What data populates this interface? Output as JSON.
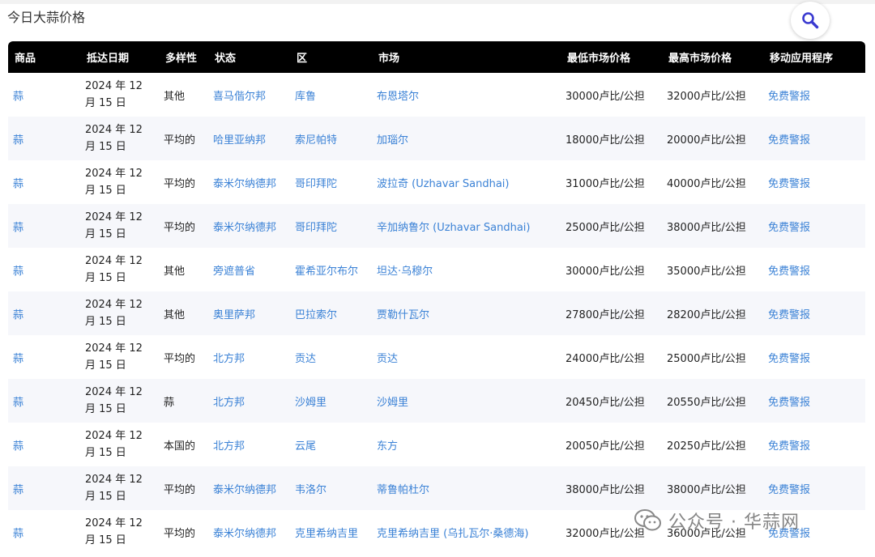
{
  "page": {
    "title": "今日大蒜价格",
    "watermark": "公众号 · 华蒜网"
  },
  "table": {
    "headers": [
      "商品",
      "抵达日期",
      "多样性",
      "状态",
      "区",
      "市场",
      "最低市场价格",
      "最高市场价格",
      "移动应用程序"
    ],
    "rows": [
      [
        "蒜",
        "2024 年 12 月 15 日",
        "其他",
        "喜马偕尔邦",
        "库鲁",
        "布恩塔尔",
        "30000卢比/公担",
        "32000卢比/公担",
        "免费警报"
      ],
      [
        "蒜",
        "2024 年 12 月 15 日",
        "平均的",
        "哈里亚纳邦",
        "索尼帕特",
        "加瑙尔",
        "18000卢比/公担",
        "20000卢比/公担",
        "免费警报"
      ],
      [
        "蒜",
        "2024 年 12 月 15 日",
        "平均的",
        "泰米尔纳德邦",
        "哥印拜陀",
        "波拉奇 (Uzhavar Sandhai)",
        "31000卢比/公担",
        "40000卢比/公担",
        "免费警报"
      ],
      [
        "蒜",
        "2024 年 12 月 15 日",
        "平均的",
        "泰米尔纳德邦",
        "哥印拜陀",
        "辛加纳鲁尔 (Uzhavar Sandhai)",
        "25000卢比/公担",
        "38000卢比/公担",
        "免费警报"
      ],
      [
        "蒜",
        "2024 年 12 月 15 日",
        "其他",
        "旁遮普省",
        "霍希亚尔布尔",
        "坦达·乌穆尔",
        "30000卢比/公担",
        "35000卢比/公担",
        "免费警报"
      ],
      [
        "蒜",
        "2024 年 12 月 15 日",
        "其他",
        "奥里萨邦",
        "巴拉索尔",
        "贾勒什瓦尔",
        "27800卢比/公担",
        "28200卢比/公担",
        "免费警报"
      ],
      [
        "蒜",
        "2024 年 12 月 15 日",
        "平均的",
        "北方邦",
        "贡达",
        "贡达",
        "24000卢比/公担",
        "25000卢比/公担",
        "免费警报"
      ],
      [
        "蒜",
        "2024 年 12 月 15 日",
        "蒜",
        "北方邦",
        "沙姆里",
        "沙姆里",
        "20450卢比/公担",
        "20550卢比/公担",
        "免费警报"
      ],
      [
        "蒜",
        "2024 年 12 月 15 日",
        "本国的",
        "北方邦",
        "云尾",
        "东方",
        "20050卢比/公担",
        "20250卢比/公担",
        "免费警报"
      ],
      [
        "蒜",
        "2024 年 12 月 15 日",
        "平均的",
        "泰米尔纳德邦",
        "韦洛尔",
        "蒂鲁帕杜尔",
        "38000卢比/公担",
        "38000卢比/公担",
        "免费警报"
      ],
      [
        "蒜",
        "2024 年 12 月 15 日",
        "平均的",
        "泰米尔纳德邦",
        "克里希纳吉里",
        "克里希纳吉里 (乌扎瓦尔·桑德海)",
        "32000卢比/公担",
        "36000卢比/公担",
        "免费警报"
      ]
    ]
  },
  "icons": {
    "search": "search-icon",
    "watermark": "wechat-icon"
  },
  "colors": {
    "header_bg": "#000000",
    "link": "#3b82d6",
    "row_alt": "#f6f7fb"
  }
}
